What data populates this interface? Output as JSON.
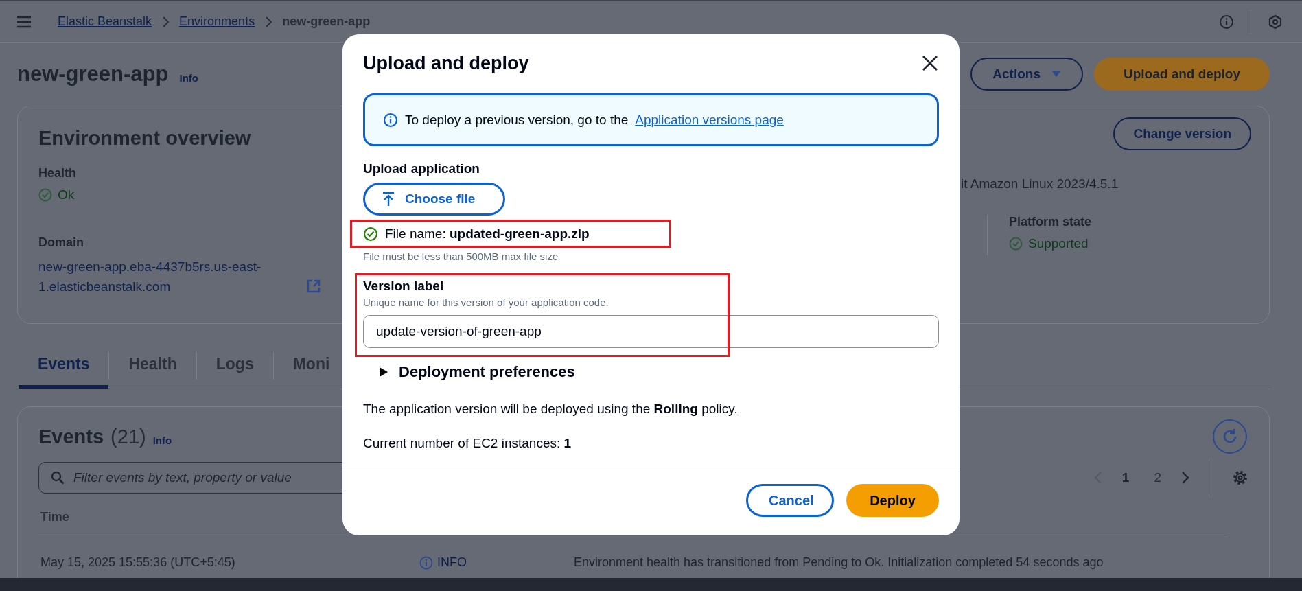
{
  "top_bar": {
    "breadcrumbs": [
      {
        "label": "Elastic Beanstalk",
        "link": true
      },
      {
        "label": "Environments",
        "link": true
      },
      {
        "label": "new-green-app",
        "link": false
      }
    ]
  },
  "header": {
    "title": "new-green-app",
    "info": "Info",
    "buttons": [
      {
        "label": "Actions",
        "kind": "dropdown"
      },
      {
        "label": "Upload and deploy",
        "kind": "primary"
      }
    ]
  },
  "overview": {
    "title": "Environment overview",
    "change_version": "Change version",
    "health_label": "Health",
    "health_value": "Ok",
    "domain_label": "Domain",
    "domain": "new-green-app.eba-4437b5rs.us-east-1.elasticbeanstalk.com",
    "platform": "it Amazon Linux 2023/4.5.1",
    "platform_state_label": "Platform state",
    "platform_state": "Supported"
  },
  "tabs": [
    {
      "label": "Events",
      "selected": true
    },
    {
      "label": "Health",
      "selected": false
    },
    {
      "label": "Logs",
      "selected": false
    },
    {
      "label": "Moni",
      "selected": false
    }
  ],
  "events": {
    "title": "Events",
    "count": "(21)",
    "info": "Info",
    "filter": {
      "placeholder": "Filter events by text, property or value"
    },
    "pagination": {
      "previous_disabled": true,
      "next_disabled": false,
      "pages": [
        {
          "label": "1",
          "selected": true
        },
        {
          "label": "2",
          "selected": false
        }
      ]
    },
    "columns": [
      "Time"
    ],
    "rows": [
      {
        "time": "May 15, 2025 15:55:36 (UTC+5:45)",
        "type": "INFO",
        "details": "Environment health has transitioned from Pending to Ok. Initialization completed 54 seconds ago"
      }
    ]
  },
  "modal": {
    "title": "Upload and deploy",
    "alert": {
      "text": "To deploy a previous version, go to the",
      "link": "Application versions page"
    },
    "upload_label": "Upload application",
    "choose_file": "Choose file",
    "file_name": "File name: **updated-green-app.zip**",
    "file_hint": "File must be less than 500MB max file size",
    "version_label": "Version label",
    "version_description": "Unique name for this version of your application code.",
    "version_value": "update-version-of-green-app",
    "deployment_preferences": {
      "label": "Deployment preferences",
      "expanded": false
    },
    "policy_text": "The application version will be deployed using the **Rolling** policy.",
    "instances_text": "Current number of EC2 instances: **1**",
    "buttons": [
      {
        "label": "Cancel",
        "kind": "normal"
      },
      {
        "label": "Deploy",
        "kind": "primary"
      }
    ]
  }
}
